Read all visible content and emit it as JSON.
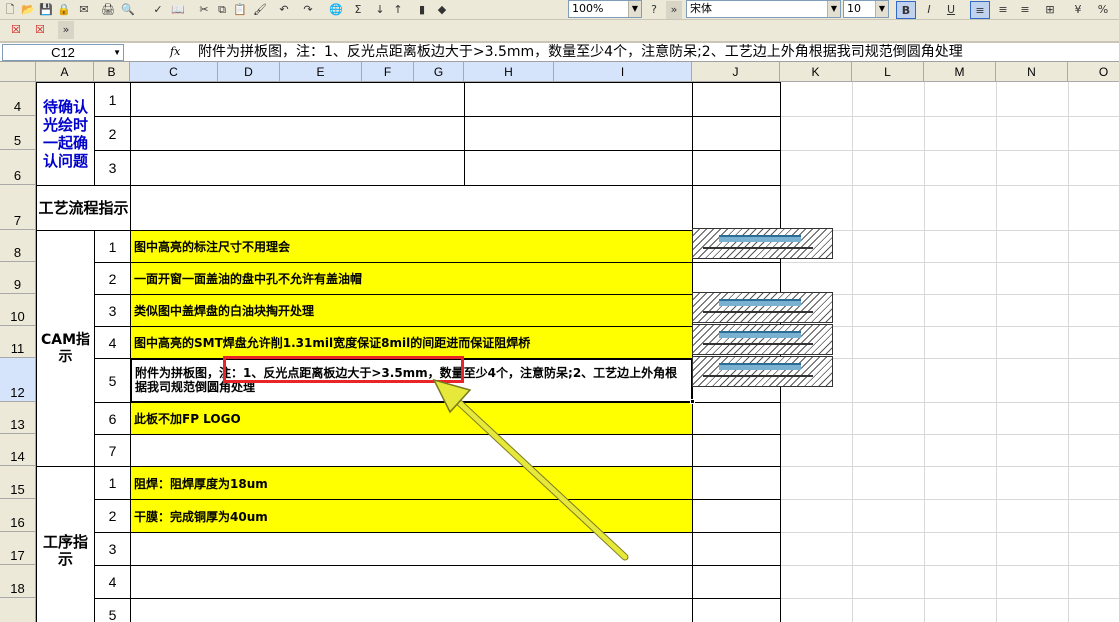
{
  "toolbar": {
    "zoom": "100%",
    "font_name": "宋体",
    "font_size": "10",
    "bold_label": "B",
    "italic_label": "I",
    "underline_label": "U",
    "sigma_label": "Σ",
    "percent_label": "%"
  },
  "formula_bar": {
    "name_box": "C12",
    "fx_label": "fx",
    "formula": "附件为拼板图，注：1、反光点距离板边大于>3.5mm，数量至少4个，注意防呆;2、工艺边上外角根据我司规范倒圆角处理"
  },
  "columns": [
    "A",
    "B",
    "C",
    "D",
    "E",
    "F",
    "G",
    "H",
    "I",
    "J",
    "K",
    "L",
    "M",
    "N",
    "O"
  ],
  "rows": [
    "4",
    "5",
    "6",
    "7",
    "8",
    "9",
    "10",
    "11",
    "12",
    "13",
    "14",
    "15",
    "16",
    "17",
    "18"
  ],
  "selected_row": "12",
  "sections": {
    "confirm": "待确认光绘时一起确认问题",
    "process_flow": "工艺流程指示",
    "cam": "CAM指示",
    "procedure": "工序指示"
  },
  "confirm_items": [
    "1",
    "2",
    "3"
  ],
  "cam_items": [
    {
      "no": "1",
      "text": "图中高亮的标注尺寸不用理会"
    },
    {
      "no": "2",
      "text": "一面开窗一面盖油的盘中孔不允许有盖油帽"
    },
    {
      "no": "3",
      "text": "类似图中盖焊盘的白油块掏开处理"
    },
    {
      "no": "4",
      "text": "图中高亮的SMT焊盘允许削1.31mil宽度保证8mil的间距进而保证阻焊桥"
    },
    {
      "no": "5",
      "text": "附件为拼板图，注：1、反光点距离板边大于>3.5mm，数量至少4个，注意防呆;2、工艺边上外角根据我司规范倒圆角处理"
    },
    {
      "no": "6",
      "text": "此板不加FP LOGO"
    },
    {
      "no": "7",
      "text": ""
    }
  ],
  "procedure_items": [
    {
      "no": "1",
      "text": "阻焊：阻焊厚度为18um"
    },
    {
      "no": "2",
      "text": "干膜：完成铜厚为40um"
    },
    {
      "no": "3",
      "text": ""
    },
    {
      "no": "4",
      "text": ""
    },
    {
      "no": "5",
      "text": ""
    }
  ],
  "colors": {
    "highlight": "#ffff00",
    "annotation": "#e8262a",
    "arrow": "#e6e83a",
    "section_text_blue": "#0000cc"
  }
}
